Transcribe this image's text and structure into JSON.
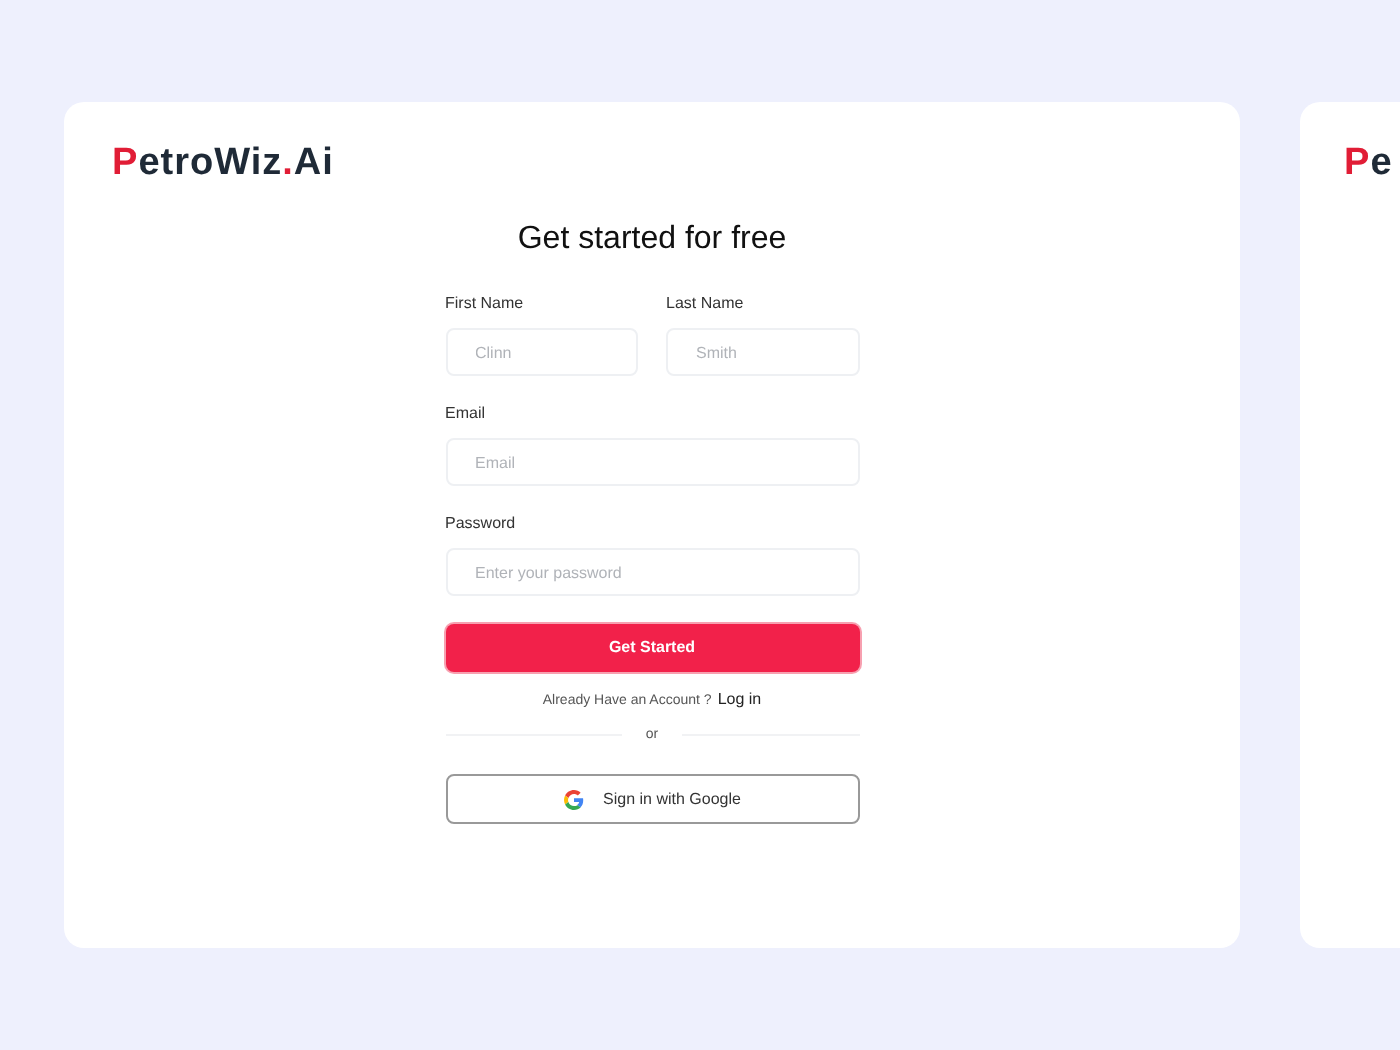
{
  "logo": {
    "parts": [
      {
        "text": "P",
        "accent": true
      },
      {
        "text": "etroWiz",
        "accent": false
      },
      {
        "text": ".",
        "accent": true
      },
      {
        "text": "Ai",
        "accent": false
      }
    ]
  },
  "title": "Get started for free",
  "fields": [
    {
      "label": "First Name",
      "placeholder": "Clinn"
    },
    {
      "label": "Last Name",
      "placeholder": "Smith"
    },
    {
      "label": "Email",
      "placeholder": "Email"
    },
    {
      "label": "Password",
      "placeholder": "Enter your password"
    }
  ],
  "submit": "Get Started",
  "login_prompt": {
    "text": "Already Have an Account ?",
    "link": "Log in"
  },
  "divider": "or",
  "google_button": "Sign in with Google",
  "next_card": {
    "logo": [
      {
        "text": "P",
        "accent": true
      },
      {
        "text": "e",
        "accent": false
      }
    ]
  }
}
